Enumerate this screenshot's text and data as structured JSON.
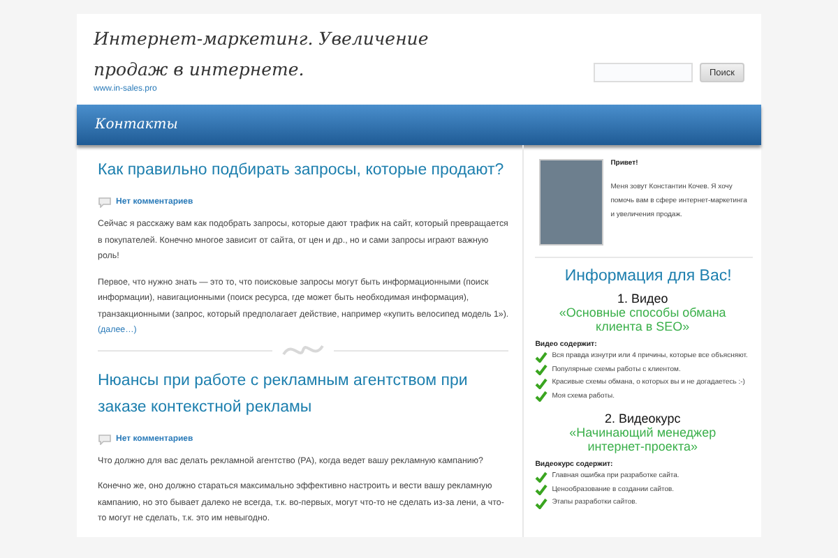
{
  "header": {
    "title": "Интернет-маркетинг. Увеличение продаж в интернете.",
    "url": "www.in-sales.pro",
    "search": {
      "button": "Поиск"
    }
  },
  "nav": {
    "items": [
      {
        "label": "Контакты"
      }
    ]
  },
  "posts": [
    {
      "title": "Как правильно подбирать запросы, которые продают?",
      "comments": "Нет комментариев",
      "paragraphs": [
        {
          "text": "Сейчас я расскажу вам как подобрать запросы, которые дают трафик на сайт, который превращается в покупателей. Конечно многое зависит от сайта, от цен и др., но и сами запросы играют важную роль!"
        },
        {
          "text": "Первое, что нужно знать — это то, что поисковые запросы могут быть информационными (поиск информации), навигационными (поиск ресурса, где может быть необходимая информация), транзакционными (запрос, который предполагает действие, например «купить велосипед модель 1»).",
          "more": "(далее…)"
        }
      ]
    },
    {
      "title": "Нюансы при работе с рекламным агентством при заказе контекстной рекламы",
      "comments": "Нет комментариев",
      "paragraphs": [
        {
          "text": "Что должно для вас делать рекламной агентство (РА), когда ведет вашу рекламную кампанию?"
        },
        {
          "text": "Конечно же, оно должно стараться максимально эффективно настроить и вести вашу рекламную кампанию, но это бывает далеко не всегда, т.к. во-первых, могут что-то не сделать из-за лени, а что-то могут не сделать, т.к. это им невыгодно."
        }
      ]
    }
  ],
  "sidebar": {
    "about": {
      "greeting": "Привет!",
      "text": "Меня зовут Константин Кочев. Я хочу помочь вам в сфере интернет-маркетинга и увеличения продаж."
    },
    "info": {
      "heading": "Информация для Вас!",
      "courses": [
        {
          "label": "1. Видео",
          "link": "«Основные способы обмана клиента в SEO»",
          "contents_label": "Видео содержит:",
          "items": [
            "Вся правда изнутри или 4 причины, которые все объясняют.",
            "Популярные схемы работы с клиентом.",
            "Красивые схемы обмана, о которых вы и не догадаетесь :-)",
            "Моя схема работы."
          ]
        },
        {
          "label": "2. Видеокурс",
          "link": "«Начинающий менеджер интернет-проекта»",
          "contents_label": "Видеокурс содержит:",
          "items": [
            "Главная ошибка при разработке сайта.",
            "Ценообразование в создании сайтов.",
            "Этапы разработки сайтов."
          ]
        }
      ]
    }
  }
}
